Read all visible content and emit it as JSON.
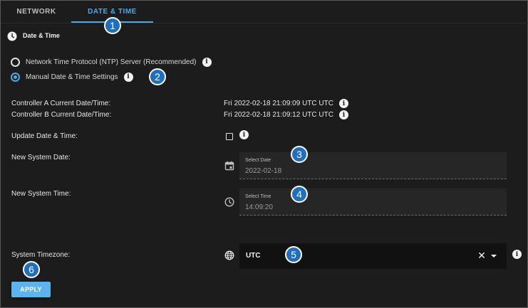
{
  "tabs": [
    {
      "label": "NETWORK",
      "active": false
    },
    {
      "label": "DATE & TIME",
      "active": true
    }
  ],
  "section": {
    "title": "Date & Time",
    "icon": "clock-icon"
  },
  "radios": {
    "ntp": {
      "label": "Network Time Protocol (NTP) Server (Recommended)",
      "checked": false
    },
    "manual": {
      "label": "Manual Date & Time Settings",
      "checked": true
    }
  },
  "info_glyph": "i",
  "controller_a": {
    "label": "Controller A Current Date/Time:",
    "value": "Fri 2022-02-18 21:09:09 UTC UTC"
  },
  "controller_b": {
    "label": "Controller B Current Date/Time:",
    "value": "Fri 2022-02-18 21:09:12 UTC UTC"
  },
  "update": {
    "label": "Update Date & Time:",
    "checked": false
  },
  "new_date": {
    "label": "New System Date:",
    "caption": "Select Date",
    "value": "2022-02-18",
    "icon": "calendar-icon"
  },
  "new_time": {
    "label": "New System Time:",
    "caption": "Select Time",
    "value": "14:09:20",
    "icon": "clock-icon"
  },
  "timezone": {
    "label": "System Timezone:",
    "value": "UTC",
    "clear_glyph": "✕",
    "icon": "globe-icon"
  },
  "apply_label": "APPLY",
  "callouts": [
    "1",
    "2",
    "3",
    "4",
    "5",
    "6"
  ],
  "colors": {
    "accent": "#4aa9e6",
    "button": "#5bb4ee",
    "callout": "#1f6fc0",
    "background": "#1c1c1c"
  }
}
